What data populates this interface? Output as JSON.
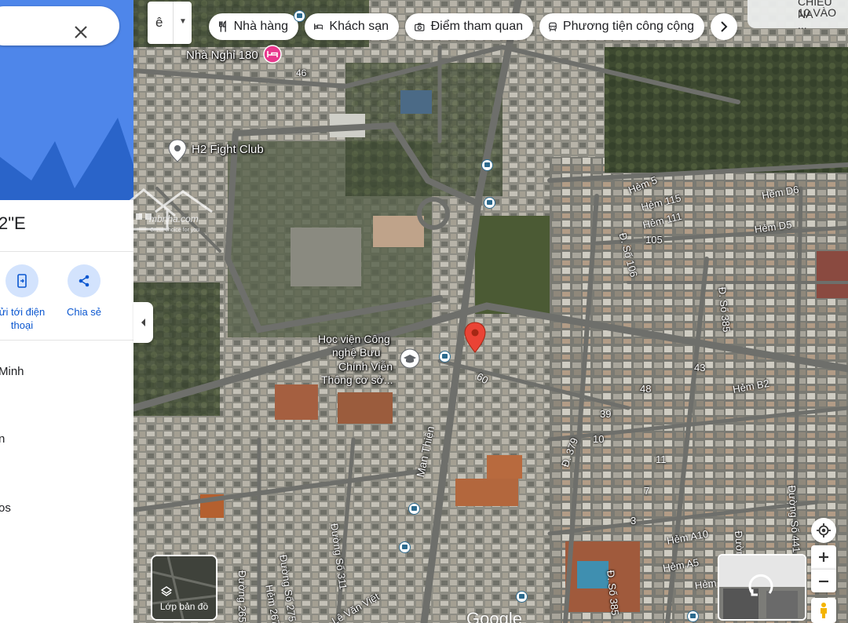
{
  "side_panel": {
    "coordinates_fragment": "2\"E",
    "actions": [
      {
        "label_line1": "ửi tới điện",
        "label_line2": "thoại",
        "icon": "send-to-phone-icon"
      },
      {
        "label_line1": "Chia sẻ",
        "icon": "share-icon"
      }
    ],
    "lines": [
      "Minh",
      "n",
      "os"
    ],
    "watermark": {
      "text": "mbnha.com",
      "subtext": "Great choice for you"
    }
  },
  "language_button": {
    "glyph": "ê",
    "icon": "dropdown-caret-icon"
  },
  "chips": [
    {
      "label": "Nhà hàng",
      "icon": "restaurant-icon"
    },
    {
      "label": "Khách sạn",
      "icon": "hotel-icon"
    },
    {
      "label": "Điểm tham quan",
      "icon": "camera-icon"
    },
    {
      "label": "Phương tiện công cộng",
      "icon": "transit-icon"
    }
  ],
  "top_right_card": {
    "line1": "CHIỀU NA",
    "line2": "10 VÀO ..."
  },
  "places": {
    "nha_nghi": "Nhà Nghỉ 180",
    "fight_club": "H2 Fight Club",
    "hoc_vien": [
      "Học viện Công",
      "nghệ Bưu",
      "Chính Viễn",
      "Thông cơ sở..."
    ]
  },
  "street_labels": {
    "s46": "46",
    "hem5": "Hẻm 5",
    "hem115": "Hẻm 115",
    "hem111": "Hẻm 111",
    "n105": "105",
    "hemd6": "Hẻm D6",
    "hemd5": "Hẻm D5",
    "ds106": "Đ. Số 106",
    "ds385a": "Đ. Số 385",
    "n43": "43",
    "n48": "48",
    "hemb2": "Hẻm B2",
    "n39": "39",
    "n10": "10",
    "n11": "11",
    "n7": "7",
    "n3": "3",
    "n60": "60",
    "d379": "Đ. 379",
    "manthien": "Man Thiện",
    "duong311": "Đường Số 311",
    "duong275": "Đường Số 275",
    "hem267": "Hẻm 267",
    "duong265": "Đường 265",
    "levanviet": "Lê Văn Việt",
    "hema10": "Hẻm A10",
    "hema5": "Hẻm A5",
    "hem": "Hẻm",
    "ds385b": "Đ. Số 385",
    "duong441": "Đường Số 441",
    "duong": "Đường"
  },
  "layers_button": {
    "label": "Lớp bản đồ"
  },
  "google_logo": "Google",
  "colors": {
    "accent": "#0b57d0",
    "pin_red": "#ea4335",
    "hotel_pink": "#e8388d",
    "hero_blue": "#4e86ea"
  }
}
